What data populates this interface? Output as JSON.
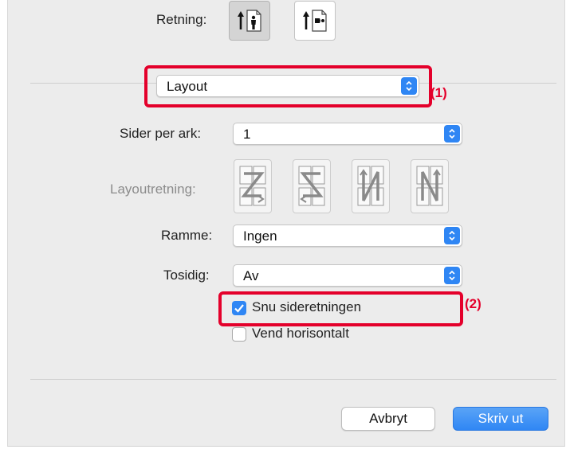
{
  "orientation": {
    "label": "Retning:",
    "options": [
      {
        "icon": "portrait-orientation-icon",
        "selected": true
      },
      {
        "icon": "landscape-orientation-icon",
        "selected": false
      }
    ]
  },
  "panel_select": {
    "value": "Layout"
  },
  "pages_per_sheet": {
    "label": "Sider per ark:",
    "value": "1"
  },
  "layout_direction": {
    "label": "Layoutretning:",
    "enabled": false,
    "options": [
      {
        "icon": "layout-z-order-icon"
      },
      {
        "icon": "layout-s-order-icon"
      },
      {
        "icon": "layout-n-reverse-order-icon"
      },
      {
        "icon": "layout-n-order-icon"
      }
    ]
  },
  "border": {
    "label": "Ramme:",
    "value": "Ingen"
  },
  "two_sided": {
    "label": "Tosidig:",
    "value": "Av"
  },
  "reverse_orientation": {
    "label": "Snu sideretningen",
    "checked": true
  },
  "flip_horizontal": {
    "label": "Vend horisontalt",
    "checked": false
  },
  "callouts": {
    "one": "(1)",
    "two": "(2)"
  },
  "buttons": {
    "cancel": "Avbryt",
    "print": "Skriv ut"
  },
  "colors": {
    "accent": "#2f86f4",
    "callout": "#e4002b",
    "panel": "#ececec"
  }
}
